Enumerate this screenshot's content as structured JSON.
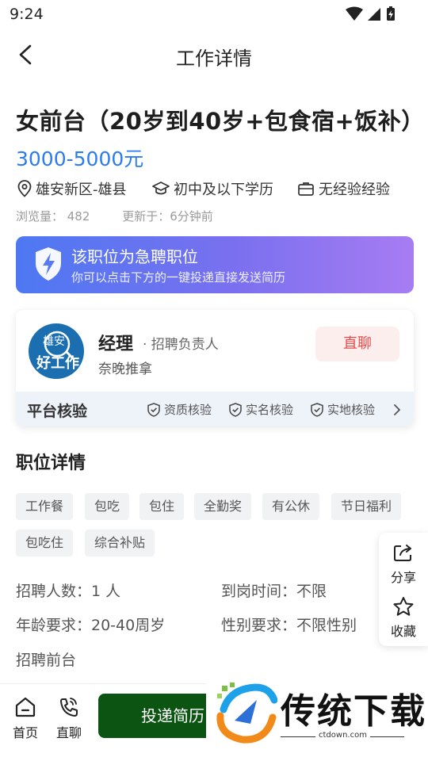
{
  "status_bar": {
    "time": "9:24"
  },
  "nav": {
    "title": "工作详情"
  },
  "job": {
    "title": "女前台（20岁到40岁+包食宿+饭补）",
    "salary": "3000-5000元",
    "location": "雄安新区-雄县",
    "education": "初中及以下学历",
    "experience": "无经验经验",
    "views": "浏览量： 482",
    "updated": "更新于：6分钟前"
  },
  "urgent_banner": {
    "title": "该职位为急聘职位",
    "subtitle": "你可以点击下方的一键投递直接发送简历",
    "colors": {
      "start": "#4d78f2",
      "end": "#a77cf2"
    }
  },
  "recruiter": {
    "logo_line1": "雄安",
    "logo_line2": "好工作",
    "name": "经理",
    "role": "· 招聘负责人",
    "company": "奈晚推拿",
    "chat_label": "直聊"
  },
  "verification": {
    "title": "平台核验",
    "items": [
      "资质核验",
      "实名核验",
      "实地核验"
    ]
  },
  "details": {
    "section_title": "职位详情",
    "tags": [
      "工作餐",
      "包吃",
      "包住",
      "全勤奖",
      "有公休",
      "节日福利",
      "包吃住",
      "综合补贴"
    ],
    "headcount": "招聘人数：1 人",
    "start_time": "到岗时间：不限",
    "age": "年龄要求：20-40周岁",
    "gender": "性别要求：不限性别",
    "description": "招聘前台"
  },
  "float_actions": {
    "share": "分享",
    "favorite": "收藏"
  },
  "bottom_bar": {
    "home": "首页",
    "chat": "直聊",
    "apply": "投递简历"
  },
  "watermark": {
    "brand": "传统下载",
    "url": "ctdown.com"
  },
  "colors": {
    "accent": "#2b7cf0",
    "apply_button": "#0b5412",
    "chat_button_text": "#e84b4b"
  }
}
